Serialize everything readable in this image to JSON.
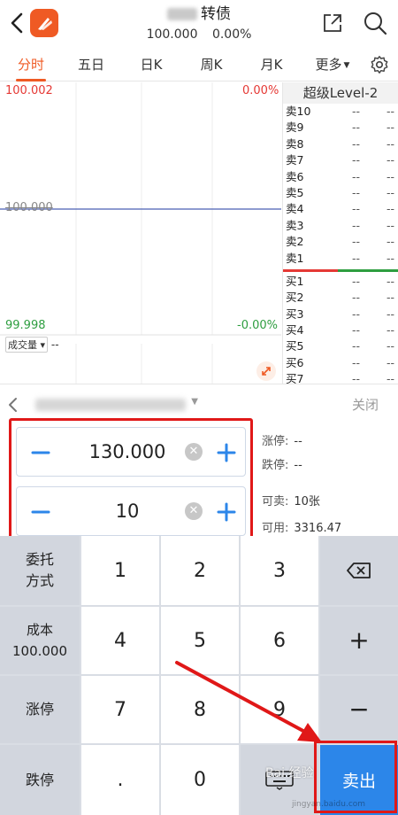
{
  "header": {
    "title_suffix": "转债",
    "price": "100.000",
    "change_pct": "0.00%"
  },
  "tabs": [
    {
      "label": "分时"
    },
    {
      "label": "五日"
    },
    {
      "label": "日K"
    },
    {
      "label": "周K"
    },
    {
      "label": "月K"
    },
    {
      "label": "更多"
    }
  ],
  "chart": {
    "price_high": "100.002",
    "pct_high": "0.00%",
    "price_mid": "100.000",
    "price_low": "99.998",
    "pct_low": "-0.00%",
    "volume_label": "成交量",
    "volume_value": "--"
  },
  "order_book": {
    "title": "超级Level-2",
    "sell": [
      {
        "label": "卖10",
        "price": "--",
        "vol": "--"
      },
      {
        "label": "卖9",
        "price": "--",
        "vol": "--"
      },
      {
        "label": "卖8",
        "price": "--",
        "vol": "--"
      },
      {
        "label": "卖7",
        "price": "--",
        "vol": "--"
      },
      {
        "label": "卖6",
        "price": "--",
        "vol": "--"
      },
      {
        "label": "卖5",
        "price": "--",
        "vol": "--"
      },
      {
        "label": "卖4",
        "price": "--",
        "vol": "--"
      },
      {
        "label": "卖3",
        "price": "--",
        "vol": "--"
      },
      {
        "label": "卖2",
        "price": "--",
        "vol": "--"
      },
      {
        "label": "卖1",
        "price": "--",
        "vol": "--"
      }
    ],
    "buy": [
      {
        "label": "买1",
        "price": "--",
        "vol": "--"
      },
      {
        "label": "买2",
        "price": "--",
        "vol": "--"
      },
      {
        "label": "买3",
        "price": "--",
        "vol": "--"
      },
      {
        "label": "买4",
        "price": "--",
        "vol": "--"
      },
      {
        "label": "买5",
        "price": "--",
        "vol": "--"
      },
      {
        "label": "买6",
        "price": "--",
        "vol": "--"
      },
      {
        "label": "买7",
        "price": "--",
        "vol": "--"
      }
    ]
  },
  "panel": {
    "close_label": "关闭",
    "price_value": "130.000",
    "qty_value": "10",
    "limit_up_label": "涨停:",
    "limit_up_value": "--",
    "limit_down_label": "跌停:",
    "limit_down_value": "--",
    "sellable_label": "可卖:",
    "sellable_value": "10张",
    "available_label": "可用:",
    "available_value": "3316.47"
  },
  "keypad": {
    "order_type_line1": "委托",
    "order_type_line2": "方式",
    "cost_line1": "成本",
    "cost_line2": "100.000",
    "limit_up": "涨停",
    "limit_down": "跌停",
    "digits": [
      "1",
      "2",
      "3",
      "4",
      "5",
      "6",
      "7",
      "8",
      "9"
    ],
    "dot": ".",
    "zero": "0",
    "plus": "+",
    "minus": "−",
    "sell_label": "卖出"
  },
  "watermark": {
    "text": "Bai 经验",
    "url": "jingyan.baidu.com"
  },
  "colors": {
    "accent": "#ef5a24",
    "up": "#e53935",
    "down": "#2e9e40",
    "key_blue": "#2c86e9",
    "stepper_blue": "#2c86e9",
    "annotation_red": "#e01818"
  }
}
